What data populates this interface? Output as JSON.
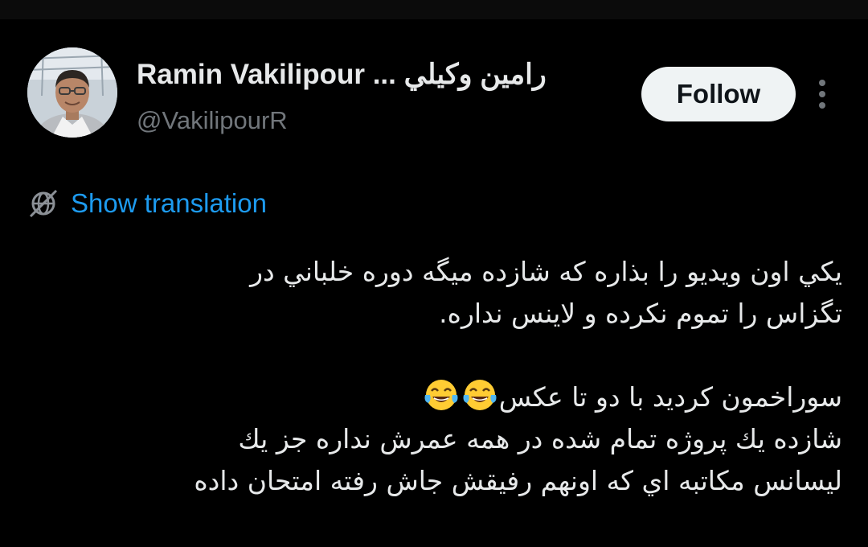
{
  "user": {
    "display_name": "Ramin Vakilipour ... رامين وكيلي",
    "handle": "@VakilipourR",
    "avatar": "avatar-photo"
  },
  "actions": {
    "follow_label": "Follow",
    "more_icon": "more-vertical-icon"
  },
  "translation": {
    "icon": "globe-icon",
    "label": "Show translation"
  },
  "tweet": {
    "lines": [
      "يكي اون ويديو را بذاره كه شازده ميگه دوره خلباني در",
      "تگزاس را تموم نكرده و لاينس نداره.",
      "",
      "سوراخمون كرديد با دو تا عكس",
      "شازده يك پروژه تمام شده در همه عمرش نداره جز يك",
      "ليسانس مكاتبه اي كه اونهم رفيقش جاش رفته امتحان داده"
    ],
    "emoji": "face-with-tears-of-joy-icon",
    "emoji_count": 2
  },
  "colors": {
    "background": "#000000",
    "text": "#e7e9ea",
    "secondary_text": "#71767b",
    "link": "#1d9bf0",
    "follow_bg": "#eff3f4",
    "follow_text": "#0f1419"
  }
}
